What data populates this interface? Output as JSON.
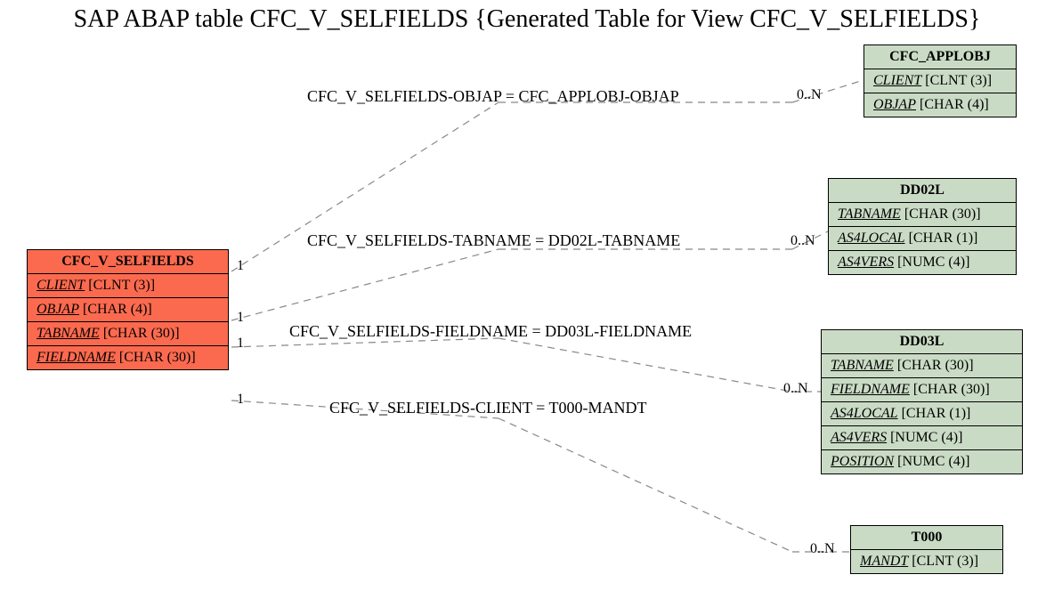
{
  "title": "SAP ABAP table CFC_V_SELFIELDS {Generated Table for View CFC_V_SELFIELDS}",
  "main": {
    "name": "CFC_V_SELFIELDS",
    "fields": [
      {
        "key": "CLIENT",
        "type": "[CLNT (3)]",
        "pk": true
      },
      {
        "key": "OBJAP",
        "type": "[CHAR (4)]",
        "pk": true
      },
      {
        "key": "TABNAME",
        "type": "[CHAR (30)]",
        "pk": true
      },
      {
        "key": "FIELDNAME",
        "type": "[CHAR (30)]",
        "pk": true
      }
    ]
  },
  "applobj": {
    "name": "CFC_APPLOBJ",
    "fields": [
      {
        "key": "CLIENT",
        "type": "[CLNT (3)]",
        "pk": true
      },
      {
        "key": "OBJAP",
        "type": "[CHAR (4)]",
        "pk": true
      }
    ]
  },
  "dd02l": {
    "name": "DD02L",
    "fields": [
      {
        "key": "TABNAME",
        "type": "[CHAR (30)]",
        "pk": true
      },
      {
        "key": "AS4LOCAL",
        "type": "[CHAR (1)]",
        "pk": true
      },
      {
        "key": "AS4VERS",
        "type": "[NUMC (4)]",
        "pk": true
      }
    ]
  },
  "dd03l": {
    "name": "DD03L",
    "fields": [
      {
        "key": "TABNAME",
        "type": "[CHAR (30)]",
        "pk": true
      },
      {
        "key": "FIELDNAME",
        "type": "[CHAR (30)]",
        "pk": true
      },
      {
        "key": "AS4LOCAL",
        "type": "[CHAR (1)]",
        "pk": true
      },
      {
        "key": "AS4VERS",
        "type": "[NUMC (4)]",
        "pk": true
      },
      {
        "key": "POSITION",
        "type": "[NUMC (4)]",
        "pk": true
      }
    ]
  },
  "t000": {
    "name": "T000",
    "fields": [
      {
        "key": "MANDT",
        "type": "[CLNT (3)]",
        "pk": true
      }
    ]
  },
  "rels": {
    "r1": "CFC_V_SELFIELDS-OBJAP = CFC_APPLOBJ-OBJAP",
    "r2": "CFC_V_SELFIELDS-TABNAME = DD02L-TABNAME",
    "r3": "CFC_V_SELFIELDS-FIELDNAME = DD03L-FIELDNAME",
    "r4": "CFC_V_SELFIELDS-CLIENT = T000-MANDT"
  },
  "card": {
    "one": "1",
    "many": "0..N"
  }
}
